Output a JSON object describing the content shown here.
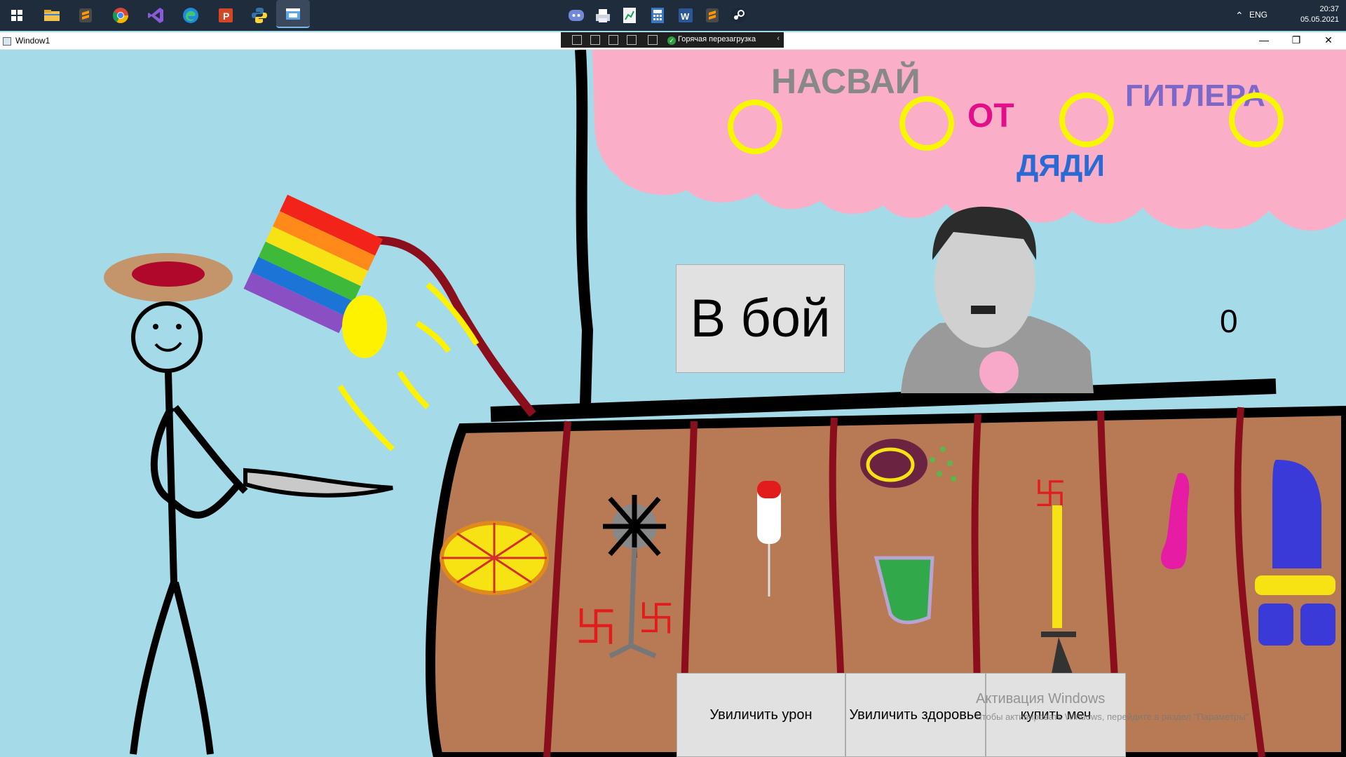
{
  "taskbar": {
    "icons": [
      "windows-start-icon",
      "file-explorer-icon",
      "sublime-text-icon",
      "chrome-icon",
      "visual-studio-icon",
      "edge-icon",
      "powerpoint-icon",
      "python-icon",
      "app-window-icon",
      "discord-icon",
      "printer-icon",
      "project-icon",
      "calculator-icon",
      "word-icon",
      "sublime-text-icon",
      "steam-icon"
    ],
    "tray": {
      "chevron": "⌃",
      "language": "ENG",
      "time": "20:37",
      "date": "05.05.2021"
    }
  },
  "window": {
    "title": "Window1",
    "hot_reload": "Горячая перезагрузка",
    "controls": [
      "minimize",
      "maximize",
      "close"
    ]
  },
  "drawing": {
    "banner_text": "НАСВАЙ ОТ ДЯДИ ГИТЛЕРА"
  },
  "game": {
    "battle_button": "В бой",
    "counter": "0",
    "upgrade_damage": "Увиличить урон",
    "upgrade_health": "Увиличить здоровье",
    "buy_sword": "купить меч"
  },
  "watermark": {
    "title": "Активация Windows",
    "text": "Чтобы активировать Windows, перейдите в раздел \"Параметры\"."
  },
  "colors": {
    "sky": "#a5dbe9",
    "cloud": "#fbaec8",
    "counter_wood": "#b77a55",
    "taskbar": "#1f2c3b"
  }
}
